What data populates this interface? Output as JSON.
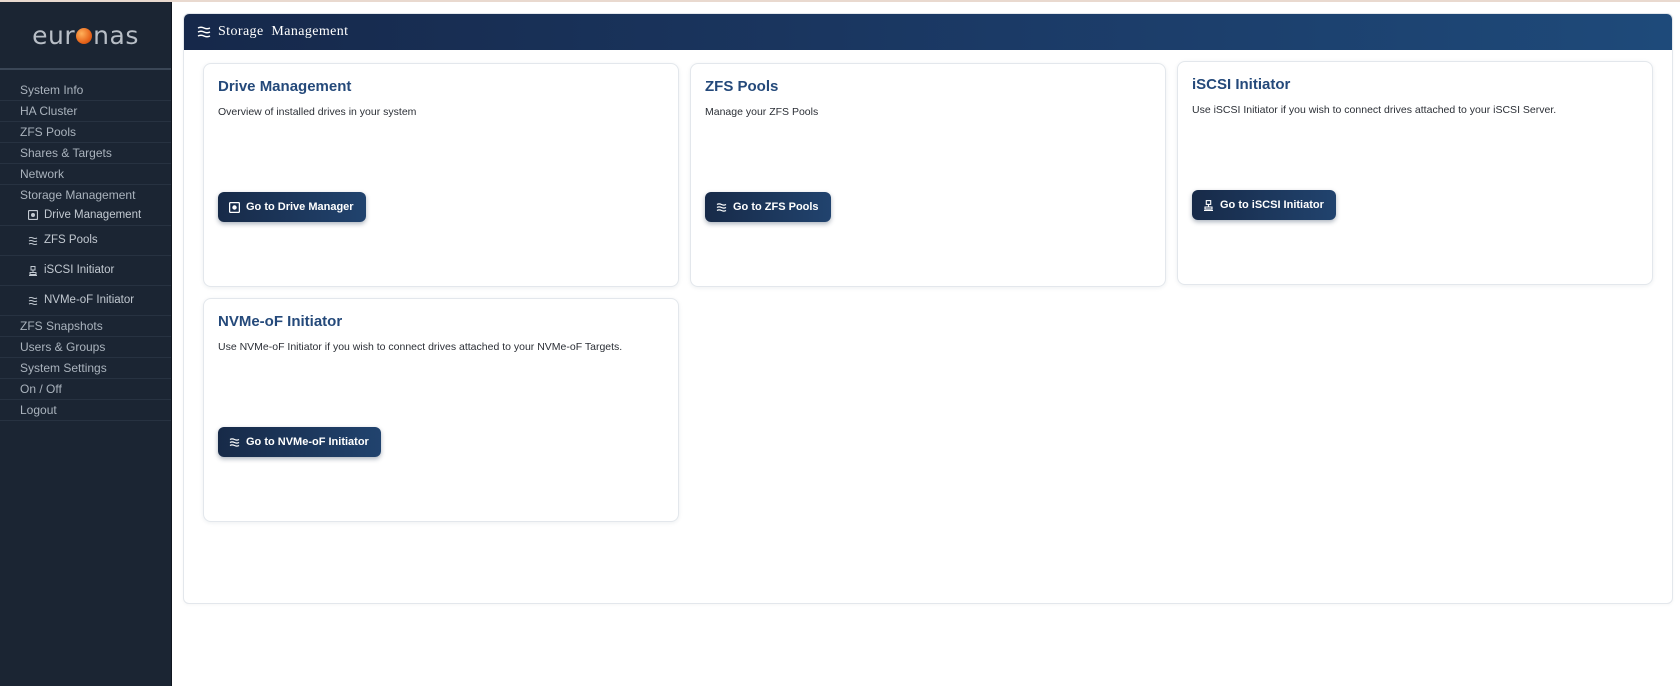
{
  "logo": {
    "text_left": "eur",
    "text_right": "nas"
  },
  "sidebar": {
    "items_top": [
      "System Info",
      "HA Cluster",
      "ZFS Pools",
      "Shares & Targets",
      "Network",
      "Storage Management"
    ],
    "sub_items": [
      {
        "label": "Drive Management",
        "icon": "drive-icon"
      },
      {
        "label": "ZFS Pools",
        "icon": "layers-icon"
      },
      {
        "label": "iSCSI Initiator",
        "icon": "network-icon"
      },
      {
        "label": "NVMe-oF Initiator",
        "icon": "layers-icon"
      }
    ],
    "items_bottom": [
      "ZFS Snapshots",
      "Users & Groups",
      "System Settings",
      "On / Off",
      "Logout"
    ]
  },
  "header": {
    "title": "Storage  Management",
    "icon": "layers-icon"
  },
  "cards": [
    {
      "title": "Drive Management",
      "description": "Overview of installed drives in your system",
      "button": "Go to Drive Manager",
      "button_icon": "drive-icon"
    },
    {
      "title": "ZFS Pools",
      "description": "Manage your ZFS Pools",
      "button": "Go to ZFS Pools",
      "button_icon": "layers-icon"
    },
    {
      "title": "iSCSI Initiator",
      "description": "Use iSCSI Initiator if you wish to connect drives attached to your iSCSI Server.",
      "button": "Go to iSCSI Initiator",
      "button_icon": "network-icon"
    },
    {
      "title": "NVMe-oF Initiator",
      "description": "Use NVMe-oF Initiator if you wish to connect drives attached to your NVMe-oF Targets.",
      "button": "Go to NVMe-oF Initiator",
      "button_icon": "layers-icon"
    }
  ],
  "colors": {
    "sidebar_bg": "#1b2533",
    "header_start": "#16284a",
    "header_end": "#1e4a7a",
    "accent": "#24497a",
    "logo_dot": "#e8661c"
  }
}
